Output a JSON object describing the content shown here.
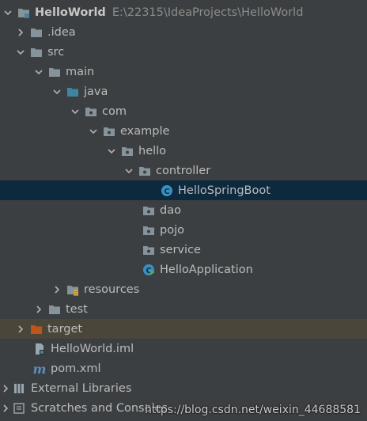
{
  "project": {
    "name": "HelloWorld",
    "path": "E:\\22315\\IdeaProjects\\HelloWorld"
  },
  "tree": {
    "idea": ".idea",
    "src": "src",
    "main": "main",
    "java": "java",
    "com": "com",
    "example": "example",
    "hello": "hello",
    "controller": "controller",
    "hello_spring_boot": "HelloSpringBoot",
    "dao": "dao",
    "pojo": "pojo",
    "service": "service",
    "hello_application": "HelloApplication",
    "resources": "resources",
    "test": "test",
    "target": "target",
    "iml": "HelloWorld.iml",
    "pom": "pom.xml",
    "external_libraries": "External Libraries",
    "scratches": "Scratches and Consoles"
  },
  "watermark": "https://blog.csdn.net/weixin_44688581",
  "colors": {
    "background": "#3c3f41",
    "selection": "#0d293e",
    "excluded_row": "#4a4639",
    "folder": "#87939a",
    "source_folder": "#3e86a0",
    "excluded_folder": "#c0541a",
    "class_icon": "#3592c4"
  }
}
